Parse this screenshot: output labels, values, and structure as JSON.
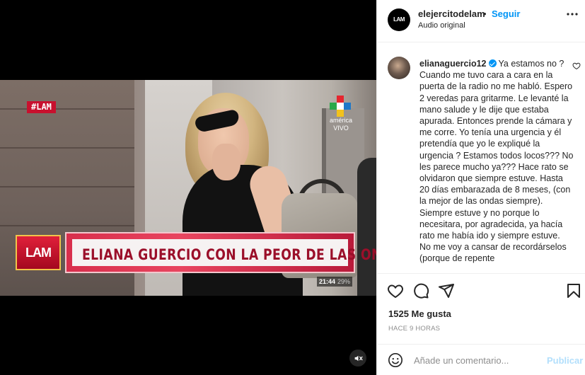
{
  "header": {
    "avatar_text": "LAM",
    "username": "elejercitodelam",
    "separator": "•",
    "follow_label": "Seguir",
    "audio_label": "Audio original"
  },
  "video": {
    "hashtag": "#LAM",
    "channel_text_1": "américa",
    "channel_text_2": "VIVO",
    "banner_logo": "LAM",
    "banner_text": "ELIANA GUERCIO CON LA PEOR DE LAS ONDAS",
    "clock_time": "21:44",
    "clock_pct": "29%"
  },
  "caption": {
    "username": "elianaguercio12",
    "text": "Ya estamos no ? Cuando me tuvo cara a cara en la puerta de la radio no me habló. Espero 2 veredas para gritarme. Le levanté la mano salude y le dije que estaba apurada. Entonces prende la cámara y me corre. Yo tenía una urgencia y él pretendía que yo le expliqué la urgencia ? Estamos todos locos??? No les parece mucho ya??? Hace rato se olvidaron que siempre estuve. Hasta 20 días embarazada de 8 meses, (con la mejor de las ondas siempre). Siempre estuve y no porque lo necesitara, por agradecida, ya hacía rato me había ido y siempre estuve. No me voy a cansar de recordárselos (porque de repente"
  },
  "actions": {
    "likes": "1525 Me gusta",
    "time": "HACE 9 HORAS"
  },
  "composer": {
    "placeholder": "Añade un comentario...",
    "publish_label": "Publicar"
  },
  "colors": {
    "accent": "#0095f6",
    "publish_disabled": "#b2dffc",
    "lam_red": "#c8102e"
  }
}
